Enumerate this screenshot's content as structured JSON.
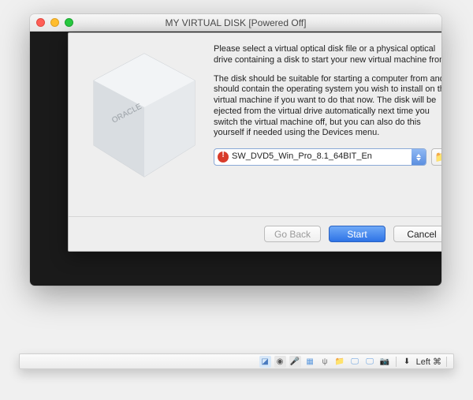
{
  "window": {
    "title": "MY VIRTUAL DISK [Powered Off]"
  },
  "dialog": {
    "paragraph1": "Please select a virtual optical disk file or a physical optical drive containing a disk to start your new virtual machine from.",
    "paragraph2": "The disk should be suitable for starting a computer from and should contain the operating system you wish to install on the virtual machine if you want to do that now. The disk will be ejected from the virtual drive automatically next time you switch the virtual machine off, but you can also do this yourself if needed using the Devices menu.",
    "disk_selection": "SW_DVD5_Win_Pro_8.1_64BIT_En",
    "logo_text": "ORACLE",
    "buttons": {
      "go_back": "Go Back",
      "start": "Start",
      "cancel": "Cancel"
    }
  },
  "statusbar": {
    "host_label": "Left ⌘"
  }
}
